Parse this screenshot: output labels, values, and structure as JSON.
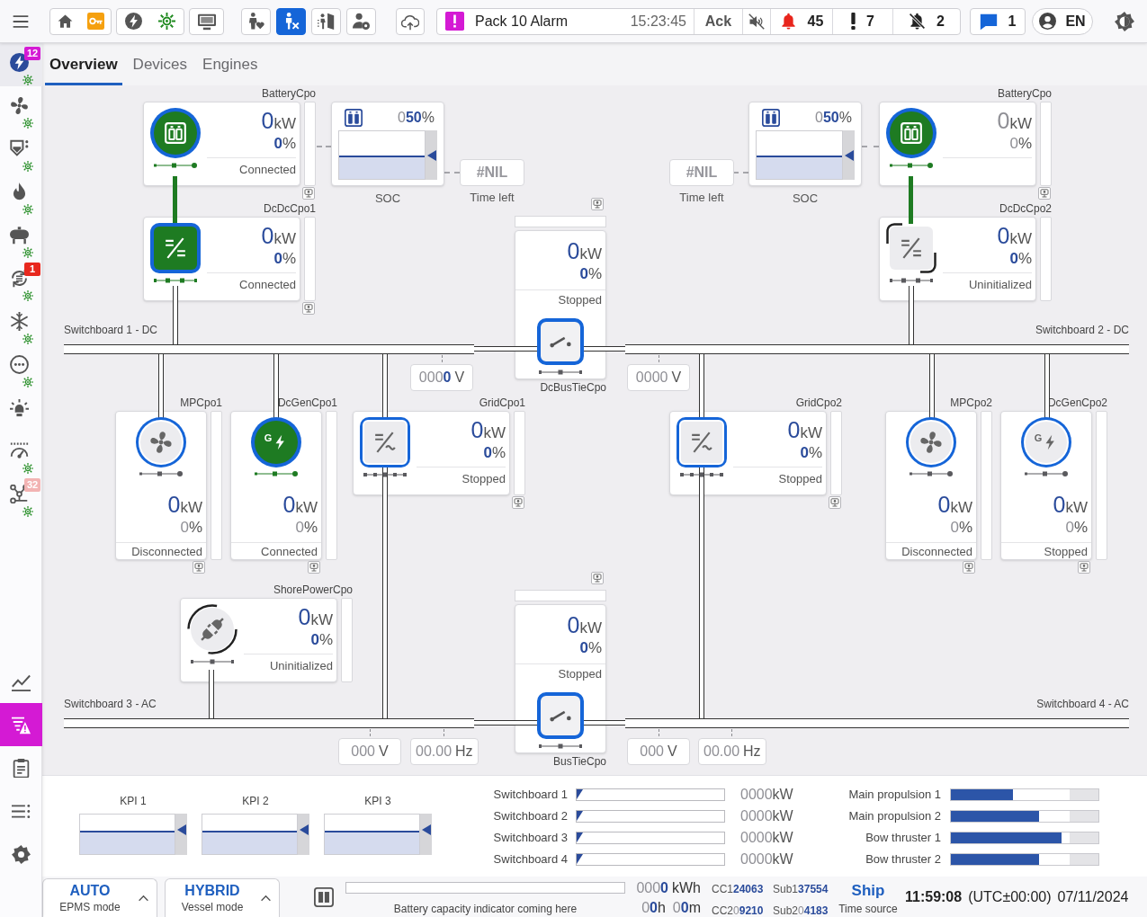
{
  "top_bar": {
    "person_modes": [
      {
        "selected": false
      },
      {
        "selected": true
      },
      {
        "selected": false
      },
      {
        "selected": false
      }
    ],
    "alarm": {
      "title": "Pack 10 Alarm",
      "time": "15:23:45",
      "ack": "Ack",
      "counts": [
        "45",
        "7",
        "2"
      ]
    },
    "messages": "1",
    "language": "EN"
  },
  "sidebar": {
    "items": [
      {
        "selected": true,
        "indicator": true,
        "badge": {
          "text": "12",
          "color": "#d41ad4"
        }
      },
      {
        "selected": false,
        "indicator": true
      },
      {
        "selected": false,
        "indicator": true
      },
      {
        "selected": false,
        "indicator": true
      },
      {
        "selected": false,
        "indicator": true
      },
      {
        "selected": false,
        "indicator": true,
        "badge": {
          "text": "1",
          "color": "#e8281e"
        }
      },
      {
        "selected": false,
        "indicator": true
      },
      {
        "selected": false,
        "indicator": true
      },
      {
        "selected": false,
        "indicator": false
      },
      {
        "selected": false,
        "indicator": true
      },
      {
        "selected": false,
        "indicator": true,
        "badge": {
          "text": "32",
          "color": "#f2b3b3"
        }
      }
    ],
    "tools": [
      {
        "selected": false
      },
      {
        "selected": true
      },
      {
        "selected": false
      },
      {
        "selected": false
      },
      {
        "selected": false
      }
    ]
  },
  "tabs": [
    {
      "label": "Overview",
      "selected": true
    },
    {
      "label": "Devices",
      "selected": false
    },
    {
      "label": "Engines",
      "selected": false
    }
  ],
  "diagram": {
    "switchboards": [
      {
        "label": "Switchboard 1 - DC",
        "readings": [
          {
            "value": "000**0**",
            "unit": "V"
          }
        ]
      },
      {
        "label": "Switchboard 2 - DC",
        "readings": [
          {
            "value": "0000",
            "unit": "V"
          }
        ]
      },
      {
        "label": "Switchboard 3 - AC",
        "readings": [
          {
            "value": "000",
            "unit": "V"
          },
          {
            "value": "00.00",
            "unit": "Hz"
          }
        ]
      },
      {
        "label": "Switchboard 4 - AC",
        "readings": [
          {
            "value": "000",
            "unit": "V"
          },
          {
            "value": "00.00",
            "unit": "Hz"
          }
        ]
      }
    ],
    "batteries": [
      {
        "soc": {
          "value": "0**50**",
          "unit": "%"
        },
        "level": 0.5,
        "soc_label": "SOC",
        "time_left": "#NIL",
        "time_left_label": "Time left"
      },
      {
        "soc": {
          "value": "0**50**",
          "unit": "%"
        },
        "level": 0.5,
        "soc_label": "SOC",
        "time_left": "#NIL",
        "time_left_label": "Time left"
      }
    ],
    "units": [
      {
        "label": "BatteryCpo",
        "kind": "battery",
        "energized": true,
        "initialized": true,
        "power": "0",
        "power_unit": "kW",
        "power_valid": true,
        "percent": "0",
        "percent_unit": "%",
        "percent_valid": true,
        "status": "Connected",
        "local_control": true
      },
      {
        "label": "DcDcCpo1",
        "kind": "dcdc",
        "energized": true,
        "initialized": true,
        "power": "0",
        "power_unit": "kW",
        "power_valid": true,
        "percent": "0",
        "percent_unit": "%",
        "percent_valid": true,
        "status": "Connected",
        "local_control": true
      },
      {
        "label": "BatteryCpo",
        "kind": "battery",
        "energized": true,
        "initialized": true,
        "power": "0",
        "power_unit": "kW",
        "power_valid": false,
        "percent": "0",
        "percent_unit": "%",
        "percent_valid": false,
        "local_control": true
      },
      {
        "label": "DcDcCpo2",
        "kind": "dcdc",
        "energized": false,
        "initialized": false,
        "power": "0",
        "power_unit": "kW",
        "power_valid": true,
        "percent": "0",
        "percent_unit": "%",
        "percent_valid": true,
        "status": "Uninitialized",
        "local_control": false
      },
      {
        "label": "MPCpo1",
        "kind": "motor",
        "energized": false,
        "initialized": true,
        "power": "0",
        "power_unit": "kW",
        "power_valid": true,
        "percent": "0",
        "percent_unit": "%",
        "percent_valid": false,
        "status": "Disconnected",
        "local_control": true
      },
      {
        "label": "DcGenCpo1",
        "kind": "generator",
        "icon_text": "G",
        "energized": true,
        "initialized": true,
        "power": "0",
        "power_unit": "kW",
        "power_valid": true,
        "percent": "0",
        "percent_unit": "%",
        "percent_valid": false,
        "status": "Connected",
        "local_control": true
      },
      {
        "label": "GridCpo1",
        "kind": "grid",
        "energized": false,
        "initialized": true,
        "power": "0",
        "power_unit": "kW",
        "power_valid": true,
        "percent": "0",
        "percent_unit": "%",
        "percent_valid": true,
        "status": "Stopped",
        "local_control": true
      },
      {
        "label": "GridCpo2",
        "kind": "grid",
        "energized": false,
        "initialized": true,
        "power": "0",
        "power_unit": "kW",
        "power_valid": true,
        "percent": "0",
        "percent_unit": "%",
        "percent_valid": true,
        "status": "Stopped",
        "local_control": true
      },
      {
        "label": "MPCpo2",
        "kind": "motor",
        "energized": false,
        "initialized": true,
        "power": "0",
        "power_unit": "kW",
        "power_valid": true,
        "percent": "0",
        "percent_unit": "%",
        "percent_valid": false,
        "status": "Disconnected",
        "local_control": true
      },
      {
        "label": "DcGenCpo2",
        "kind": "generator",
        "icon_text": "G",
        "energized": false,
        "initialized": true,
        "power": "0",
        "power_unit": "kW",
        "power_valid": true,
        "percent": "0",
        "percent_unit": "%",
        "percent_valid": false,
        "status": "Stopped",
        "local_control": true
      },
      {
        "label": "ShorePowerCpo",
        "kind": "shore",
        "energized": false,
        "initialized": false,
        "power": "0",
        "power_unit": "kW",
        "power_valid": true,
        "percent": "0",
        "percent_unit": "%",
        "percent_valid": true,
        "status": "Uninitialized",
        "local_control": false
      }
    ],
    "bus_ties": [
      {
        "label": "DcBusTieCpo",
        "power": "0",
        "power_unit": "kW",
        "power_valid": true,
        "percent": "0",
        "percent_unit": "%",
        "percent_valid": true,
        "status": "Stopped",
        "local_control": true
      },
      {
        "label": "BusTieCpo",
        "power": "0",
        "power_unit": "kW",
        "power_valid": true,
        "percent": "0",
        "percent_unit": "%",
        "percent_valid": true,
        "status": "Stopped",
        "local_control": true
      }
    ]
  },
  "kpis": [
    {
      "label": "KPI 1",
      "level": 0.6
    },
    {
      "label": "KPI 2",
      "level": 0.6
    },
    {
      "label": "KPI 3",
      "level": 0.6
    }
  ],
  "switchboard_loads": [
    {
      "label": "Switchboard 1",
      "level": 0,
      "reading": {
        "value": "0000",
        "unit": "kW"
      }
    },
    {
      "label": "Switchboard 2",
      "level": 0,
      "reading": {
        "value": "0000",
        "unit": "kW"
      }
    },
    {
      "label": "Switchboard 3",
      "level": 0,
      "reading": {
        "value": "0000",
        "unit": "kW"
      }
    },
    {
      "label": "Switchboard 4",
      "level": 0,
      "reading": {
        "value": "0000",
        "unit": "kW"
      }
    }
  ],
  "propulsion_loads": [
    {
      "label": "Main propulsion 1",
      "level": 0.42
    },
    {
      "label": "Main propulsion 2",
      "level": 0.6
    },
    {
      "label": "Bow thruster 1",
      "level": 0.75
    },
    {
      "label": "Bow thruster 2",
      "level": 0.6
    }
  ],
  "status_bar": {
    "modes": [
      {
        "value": "AUTO",
        "label": "EPMS mode"
      },
      {
        "value": "HYBRID",
        "label": "Vessel mode"
      }
    ],
    "battery_caption": "Battery capacity indicator coming here",
    "energy": {
      "value": "000**0**",
      "unit": "kWh"
    },
    "duration": [
      {
        "value": "0**0**",
        "unit": "h"
      },
      {
        "value": "0**0**",
        "unit": "m"
      }
    ],
    "counters": [
      {
        "label": "CC1",
        "value": "24063",
        "leading_zeros": false
      },
      {
        "label": "Sub1",
        "value": "37554",
        "leading_zeros": false
      },
      {
        "label": "CC2",
        "value": "0**9210**",
        "leading_zeros": true
      },
      {
        "label": "Sub2",
        "value": "0**4183**",
        "leading_zeros": true
      }
    ],
    "time_source": {
      "value": "Ship",
      "label": "Time source"
    },
    "clock": {
      "time": "11:59:08",
      "zone": "(UTC±00:00)",
      "date": "07/11/2024"
    }
  }
}
